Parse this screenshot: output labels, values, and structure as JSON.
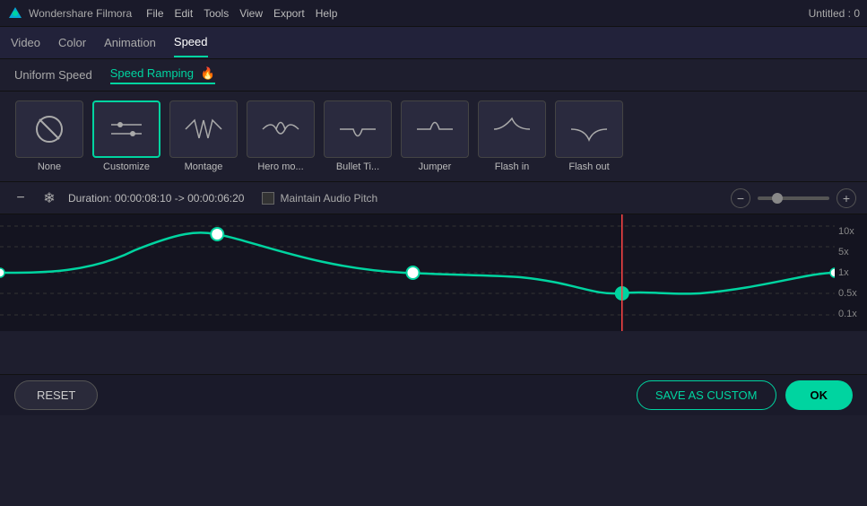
{
  "titlebar": {
    "app_name": "Wondershare Filmora",
    "menus": [
      "File",
      "Edit",
      "Tools",
      "View",
      "Export",
      "Help"
    ],
    "title": "Untitled : 0"
  },
  "tabbar": {
    "items": [
      {
        "label": "Video",
        "active": false
      },
      {
        "label": "Color",
        "active": false
      },
      {
        "label": "Animation",
        "active": false
      },
      {
        "label": "Speed",
        "active": true
      }
    ]
  },
  "speed_tabs": {
    "uniform": "Uniform Speed",
    "ramping": "Speed Ramping",
    "ramping_icon": "🔥"
  },
  "presets": [
    {
      "id": "none",
      "label": "None",
      "selected": false
    },
    {
      "id": "customize",
      "label": "Customize",
      "selected": true
    },
    {
      "id": "montage",
      "label": "Montage",
      "selected": false
    },
    {
      "id": "hero_mo",
      "label": "Hero mo...",
      "selected": false
    },
    {
      "id": "bullet_ti",
      "label": "Bullet Ti...",
      "selected": false
    },
    {
      "id": "jumper",
      "label": "Jumper",
      "selected": false
    },
    {
      "id": "flash_in",
      "label": "Flash in",
      "selected": false
    },
    {
      "id": "flash_out",
      "label": "Flash out",
      "selected": false
    }
  ],
  "controls": {
    "duration_text": "Duration: 00:00:08:10 -> 00:00:06:20",
    "audio_pitch_label": "Maintain Audio Pitch"
  },
  "graph": {
    "y_labels": [
      "10x",
      "5x",
      "1x",
      "0.5x",
      "0.1x"
    ]
  },
  "bottom": {
    "reset_label": "RESET",
    "save_custom_label": "SAVE AS CUSTOM",
    "ok_label": "OK"
  }
}
